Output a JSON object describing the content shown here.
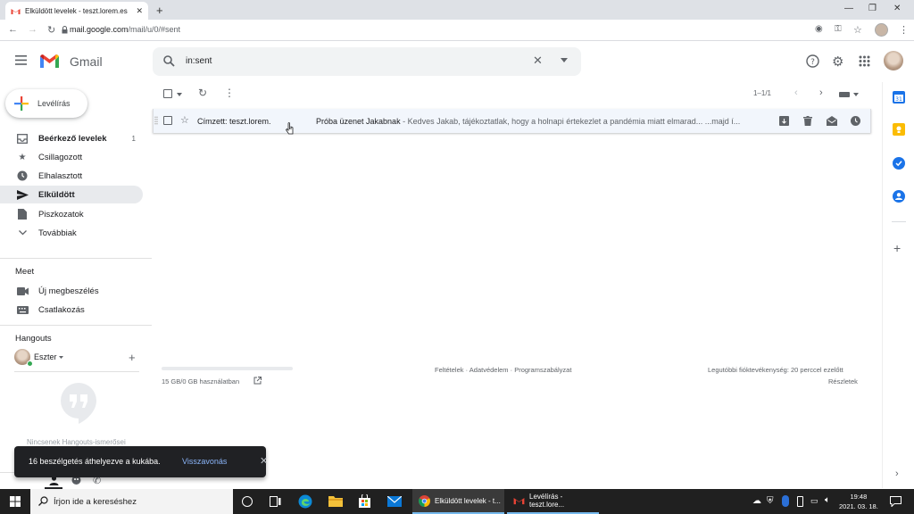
{
  "browser": {
    "tab_title": "Elküldött levelek - teszt.lorem.es",
    "url_host": "mail.google.com",
    "url_path": "/mail/u/0/#sent"
  },
  "gmail": {
    "logo_text": "Gmail",
    "search_value": "in:sent"
  },
  "sidebar": {
    "compose_label": "Levélírás",
    "items": [
      {
        "label": "Beérkező levelek",
        "count": "1",
        "icon": "inbox-icon"
      },
      {
        "label": "Csillagozott",
        "count": "",
        "icon": "star-icon"
      },
      {
        "label": "Elhalasztott",
        "count": "",
        "icon": "clock-icon"
      },
      {
        "label": "Elküldött",
        "count": "",
        "icon": "send-icon"
      },
      {
        "label": "Piszkozatok",
        "count": "",
        "icon": "draft-icon"
      },
      {
        "label": "Továbbiak",
        "count": "",
        "icon": "chevron-down-icon"
      }
    ],
    "meet_heading": "Meet",
    "meet_items": [
      {
        "label": "Új megbeszélés",
        "icon": "video-icon"
      },
      {
        "label": "Csatlakozás",
        "icon": "keyboard-icon"
      }
    ],
    "hangouts_heading": "Hangouts",
    "hangouts_user": "Eszter",
    "hangouts_empty": "Nincsenek Hangouts-ismerősei"
  },
  "toolbar": {
    "pager": "1–1/1"
  },
  "mail": {
    "sender": "Címzett: teszt.lorem.",
    "subject": "Próba üzenet Jakabnak",
    "snippet": " - Kedves Jakab, tájékoztatlak, hogy a holnapi értekezlet a pandémia miatt elmarad... ...majd í..."
  },
  "footer": {
    "storage": "15 GB/0 GB használatban",
    "links": "Feltételek · Adatvédelem · Programszabályzat",
    "activity": "Legutóbbi fióktevékenység: 20 perccel ezelőtt",
    "details": "Részletek"
  },
  "snackbar": {
    "message": "16 beszélgetés áthelyezve a kukába.",
    "undo": "Visszavonás"
  },
  "taskbar": {
    "search_placeholder": "Írjon ide a kereséshez",
    "app1": "Elküldött levelek - t...",
    "app2": "Levélírás - teszt.lore...",
    "time": "19:48",
    "date": "2021. 03. 18."
  },
  "colors": {
    "gmail_red": "#ea4335",
    "accent_blue": "#1a73e8",
    "taskbar": "#202020"
  }
}
